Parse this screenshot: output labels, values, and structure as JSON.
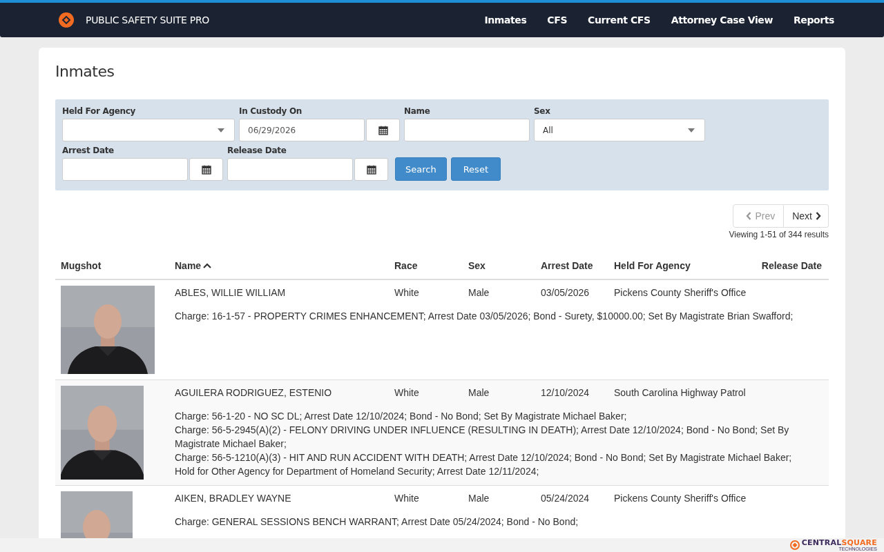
{
  "navbar": {
    "brand": "PUBLIC SAFETY SUITE PRO",
    "links": [
      {
        "label": "Inmates"
      },
      {
        "label": "CFS"
      },
      {
        "label": "Current CFS"
      },
      {
        "label": "Attorney Case View"
      },
      {
        "label": "Reports"
      }
    ]
  },
  "page_title": "Inmates",
  "filters": [
    {
      "kind": "select",
      "label": "Held For Agency"
    },
    {
      "kind": "date",
      "label": "In Custody On",
      "value": "06/29/2026"
    },
    {
      "kind": "text",
      "label": "Name"
    },
    {
      "kind": "select",
      "label": "Sex",
      "value": "All"
    },
    {
      "kind": "date",
      "label": "Arrest Date"
    },
    {
      "kind": "date",
      "label": "Release Date"
    }
  ],
  "buttons": [
    "Search",
    "Reset"
  ],
  "pagination": {
    "prev": "Prev",
    "next": "Next",
    "prev_disabled": true,
    "summary": "Viewing 1-51 of 344 results"
  },
  "table": {
    "columns": [
      {
        "label": "Mugshot",
        "sorted": false
      },
      {
        "label": "Name",
        "sorted": true
      },
      {
        "label": "Race",
        "sorted": false
      },
      {
        "label": "Sex",
        "sorted": false
      },
      {
        "label": "Arrest Date",
        "sorted": false
      },
      {
        "label": "Held For Agency",
        "sorted": false
      },
      {
        "label": "Release Date",
        "sorted": false
      }
    ],
    "rows": [
      {
        "mugshot": {
          "kind": "picture"
        },
        "name": "ABLES, WILLIE WILLIAM",
        "race": "White",
        "sex": "Male",
        "arrest_date": "03/05/2026",
        "held_for_agency": "Pickens County Sheriff's Office",
        "charges": [
          "Charge: 16-1-57 - PROPERTY CRIMES ENHANCEMENT; Arrest Date 03/05/2026; Bond - Surety, $10000.00; Set By Magistrate Brian Swafford;"
        ]
      },
      {
        "mugshot": {
          "kind": "picture"
        },
        "name": "AGUILERA RODRIGUEZ, ESTENIO",
        "race": "White",
        "sex": "Male",
        "arrest_date": "12/10/2024",
        "held_for_agency": "South Carolina Highway Patrol",
        "charges": [
          "Charge: 56-1-20 - NO SC DL; Arrest Date 12/10/2024; Bond - No Bond; Set By Magistrate Michael Baker;",
          "Charge: 56-5-2945(A)(2) - FELONY DRIVING UNDER INFLUENCE (RESULTING IN DEATH); Arrest Date 12/10/2024; Bond - No Bond; Set By Magistrate Michael Baker;",
          "Charge: 56-5-1210(A)(3) - HIT AND RUN ACCIDENT WITH DEATH; Arrest Date 12/10/2024; Bond - No Bond; Set By Magistrate Michael Baker;",
          "Hold for Other Agency for Department of Homeland Security; Arrest Date 12/11/2024;"
        ]
      },
      {
        "mugshot": {
          "kind": "picture"
        },
        "name": "AIKEN, BRADLEY WAYNE",
        "race": "White",
        "sex": "Male",
        "arrest_date": "05/24/2024",
        "held_for_agency": "Pickens County Sheriff's Office",
        "charges": [
          "Charge: GENERAL SESSIONS BENCH WARRANT; Arrest Date 05/24/2024; Bond - No Bond;"
        ]
      }
    ]
  },
  "footer": {
    "logo_parts": [
      "CENTRAL",
      "SQUARE"
    ],
    "logo_tagline": "TECHNOLOGIES"
  }
}
